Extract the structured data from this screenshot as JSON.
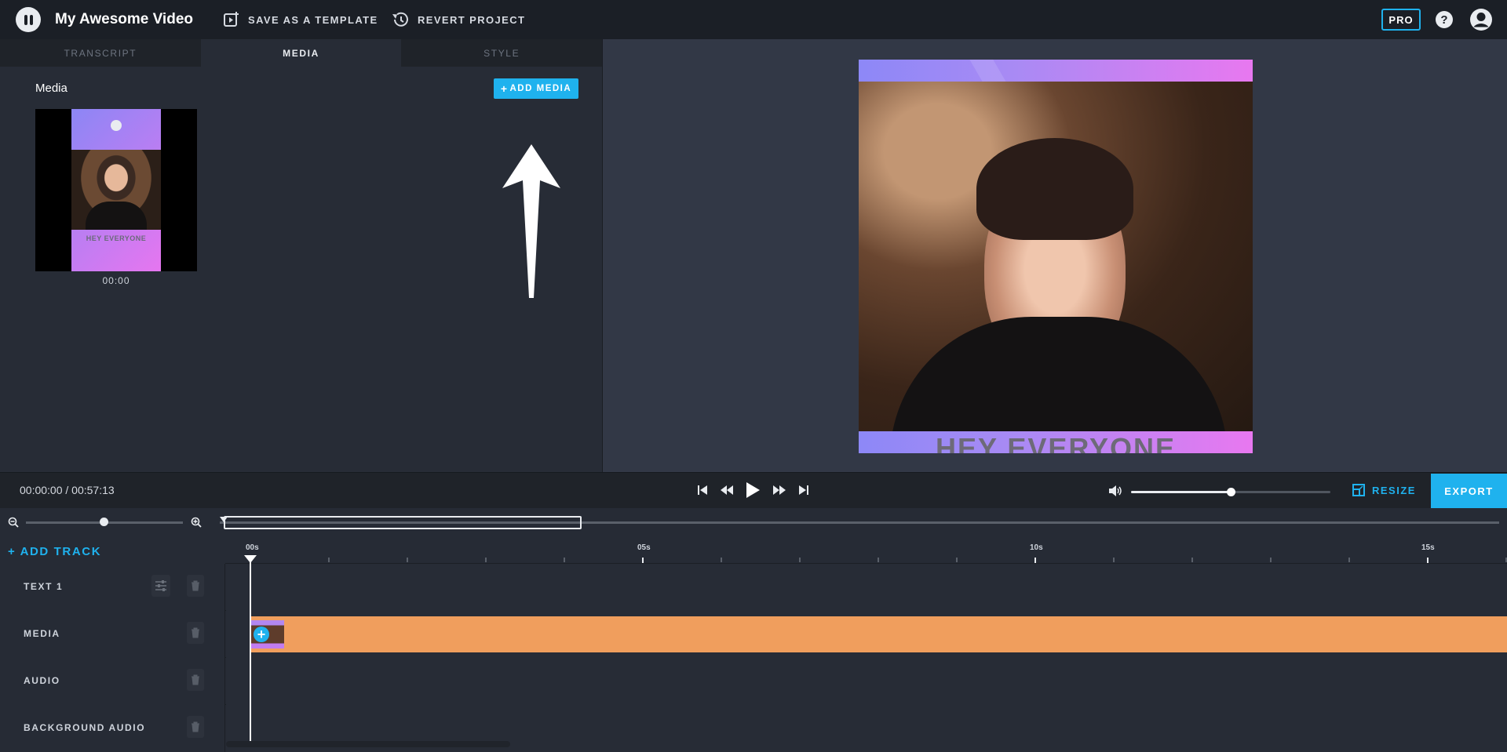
{
  "app": {
    "project_title": "My Awesome Video",
    "save_template_label": "SAVE AS A TEMPLATE",
    "revert_label": "REVERT PROJECT",
    "pro_label": "PRO",
    "help_glyph": "?"
  },
  "tabs": [
    {
      "label": "TRANSCRIPT",
      "active": false
    },
    {
      "label": "MEDIA",
      "active": true
    },
    {
      "label": "STYLE",
      "active": false
    }
  ],
  "media_panel": {
    "heading": "Media",
    "add_media_label": "ADD MEDIA",
    "item_time": "00:00",
    "item_caption": "HEY EVERYONE"
  },
  "preview": {
    "caption": "HEY EVERYONE"
  },
  "transport": {
    "timecode": "00:00:00 / 00:57:13",
    "volume_fraction": 0.5,
    "resize_label": "RESIZE",
    "export_label": "EXPORT"
  },
  "timeline": {
    "add_track_label": "+ ADD TRACK",
    "ruler_labels": [
      "00s",
      "05s",
      "10s",
      "15s"
    ],
    "tracks": [
      {
        "name": "TEXT 1"
      },
      {
        "name": "MEDIA"
      },
      {
        "name": "AUDIO"
      },
      {
        "name": "BACKGROUND AUDIO"
      }
    ]
  },
  "colors": {
    "accent": "#1fb2ee",
    "clip": "#f09e5d",
    "topbar": "#1b1f26"
  },
  "icons": [
    "logo-icon",
    "template-icon",
    "revert-icon",
    "help-icon",
    "user-icon",
    "skip-start-icon",
    "rewind-icon",
    "play-icon",
    "fast-forward-icon",
    "skip-end-icon",
    "volume-icon",
    "resize-icon",
    "zoom-out-icon",
    "zoom-in-icon",
    "settings-icon",
    "trash-icon"
  ]
}
